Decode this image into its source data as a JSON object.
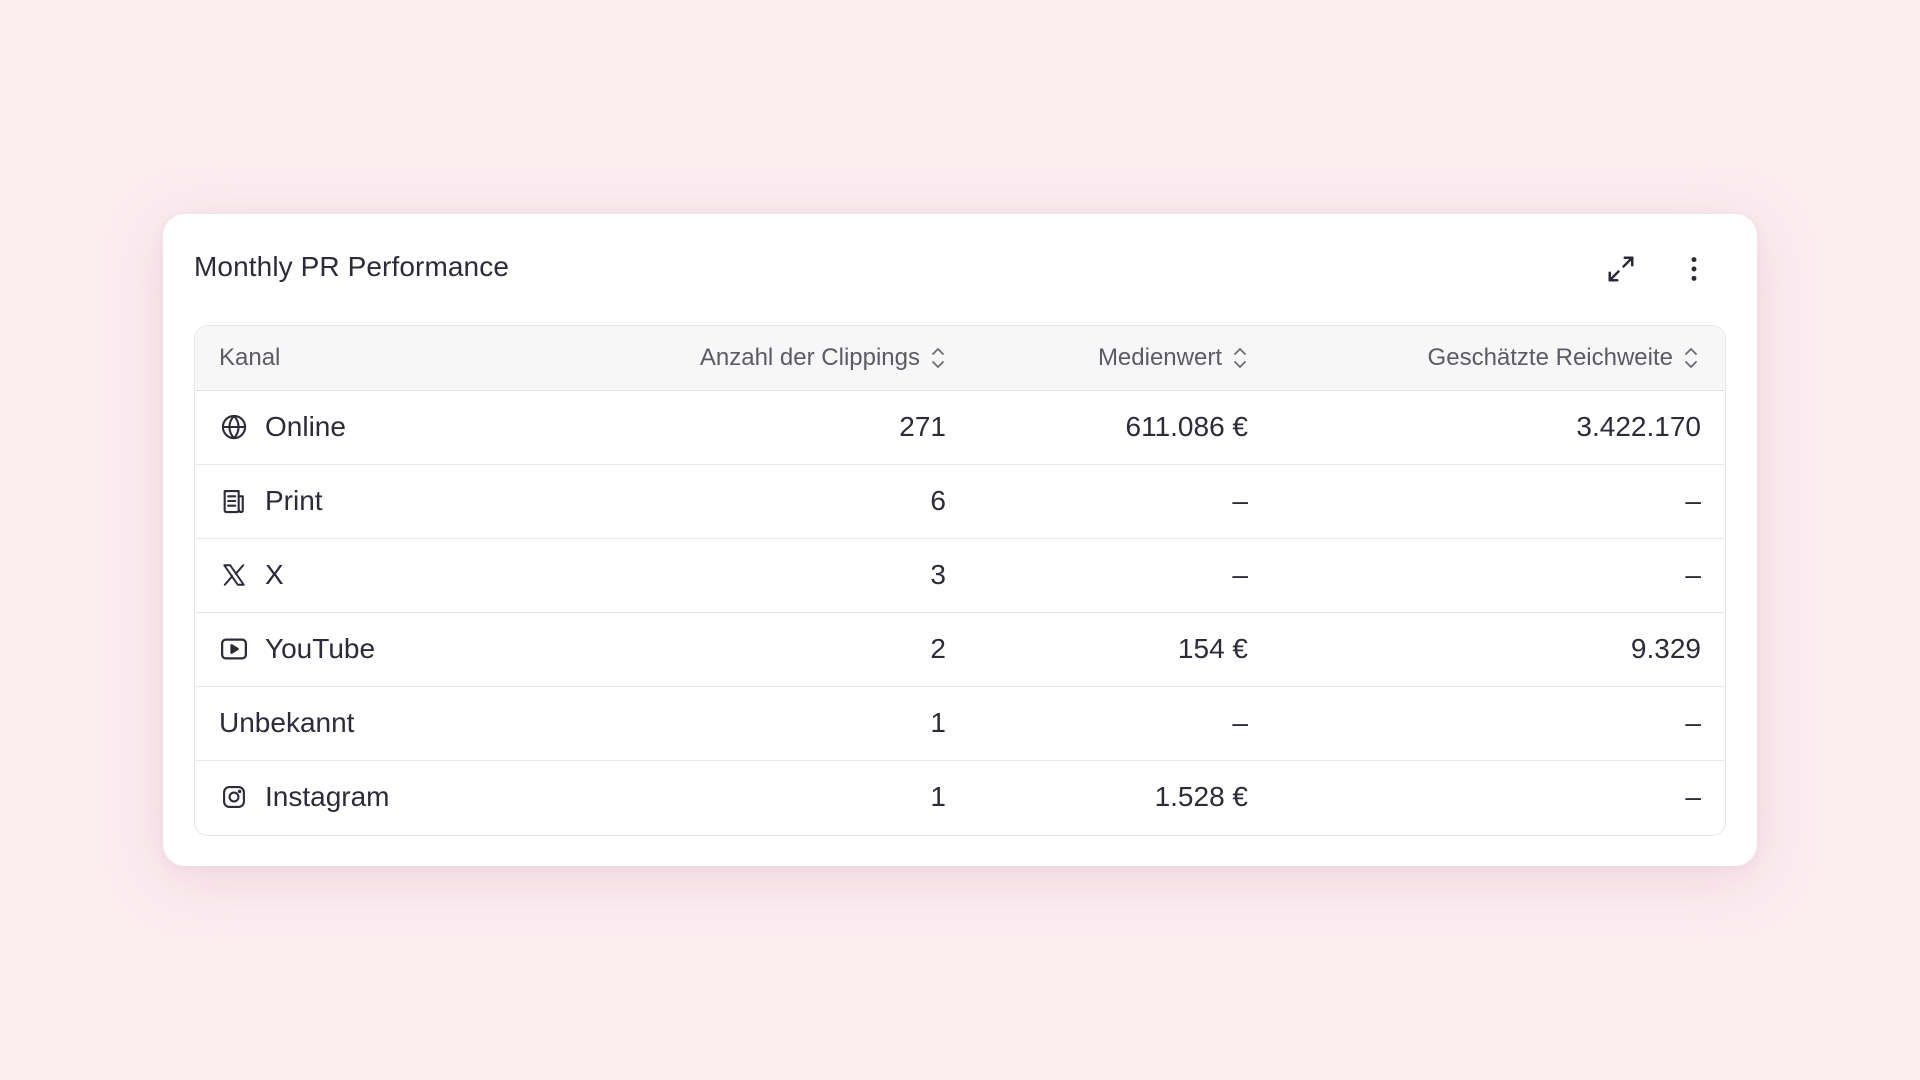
{
  "widget": {
    "title": "Monthly PR Performance",
    "actions": {
      "expand_icon": "expand-icon",
      "more_icon": "more-vertical-icon"
    }
  },
  "table": {
    "columns": [
      {
        "label": "Kanal",
        "sortable": false
      },
      {
        "label": "Anzahl der Clippings",
        "sortable": true
      },
      {
        "label": "Medienwert",
        "sortable": true
      },
      {
        "label": "Geschätzte Reichweite",
        "sortable": true
      }
    ],
    "rows": [
      {
        "channel": "Online",
        "icon": "globe-icon",
        "clippings": "271",
        "medienwert": "611.086 €",
        "reichweite": "3.422.170"
      },
      {
        "channel": "Print",
        "icon": "newspaper-icon",
        "clippings": "6",
        "medienwert": "–",
        "reichweite": "–"
      },
      {
        "channel": "X",
        "icon": "x-logo-icon",
        "clippings": "3",
        "medienwert": "–",
        "reichweite": "–"
      },
      {
        "channel": "YouTube",
        "icon": "youtube-icon",
        "clippings": "2",
        "medienwert": "154 €",
        "reichweite": "9.329"
      },
      {
        "channel": "Unbekannt",
        "icon": "",
        "clippings": "1",
        "medienwert": "–",
        "reichweite": "–"
      },
      {
        "channel": "Instagram",
        "icon": "instagram-icon",
        "clippings": "1",
        "medienwert": "1.528 €",
        "reichweite": "–"
      }
    ]
  },
  "colors": {
    "background": "#fcedf1",
    "card": "#ffffff",
    "text": "#2b2b3a",
    "header_text": "#5b5b66",
    "header_bg": "#f7f7f8",
    "border": "#e7e7ea"
  }
}
